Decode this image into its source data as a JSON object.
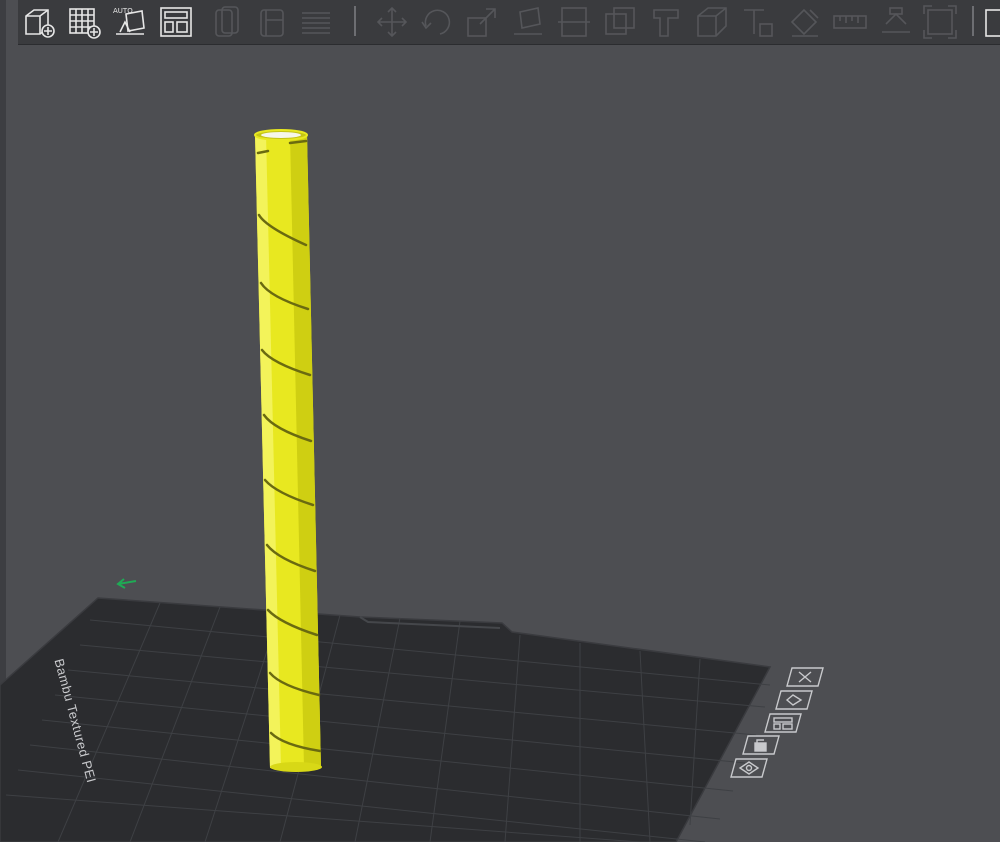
{
  "plate": {
    "label": "Bambu Textured PEI"
  },
  "colors": {
    "background": "#4d4e52",
    "toolbar": "#3a3b3e",
    "model_yellow": "#e6e61a",
    "bed": "#2b2c2f",
    "grid": "#44464a",
    "axis_green": "#1faa55"
  },
  "toolbar": {
    "primary_tools": [
      "add-model-icon",
      "add-plate-icon",
      "auto-orient-icon",
      "arrange-icon"
    ],
    "auto_orient_badge": "AUTO",
    "secondary_tools": [
      "split-objects-icon",
      "split-parts-icon",
      "variable-layer-icon"
    ],
    "transform_tools": [
      "move-icon",
      "rotate-icon",
      "scale-icon",
      "lay-on-face-icon",
      "cut-icon",
      "boolean-icon",
      "support-paint-icon",
      "seam-paint-icon",
      "measure-icon",
      "text-icon",
      "color-paint-icon",
      "ruler-icon",
      "assembly-icon",
      "fit-view-icon"
    ]
  },
  "plate_buttons": [
    "close-plate-icon",
    "auto-orient-plate-icon",
    "arrange-plate-icon",
    "lock-plate-icon",
    "plate-settings-icon"
  ]
}
